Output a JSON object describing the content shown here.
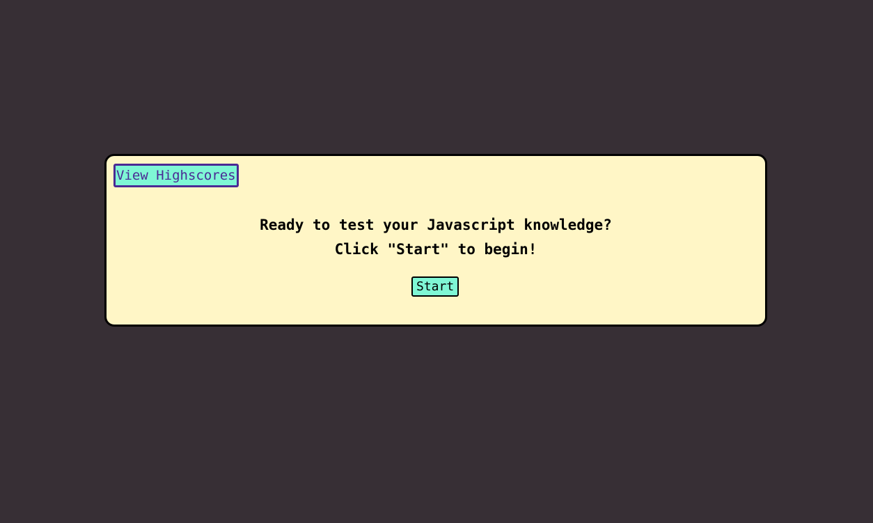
{
  "header": {
    "highscores_label": "View Highscores"
  },
  "intro": {
    "line1": "Ready to test your Javascript knowledge?",
    "line2": "Click \"Start\" to begin!"
  },
  "actions": {
    "start_label": "Start"
  },
  "colors": {
    "page_background": "#372f35",
    "card_background": "#fff6c6",
    "button_background": "#7ff7d5",
    "link_border": "#4b2a94"
  }
}
